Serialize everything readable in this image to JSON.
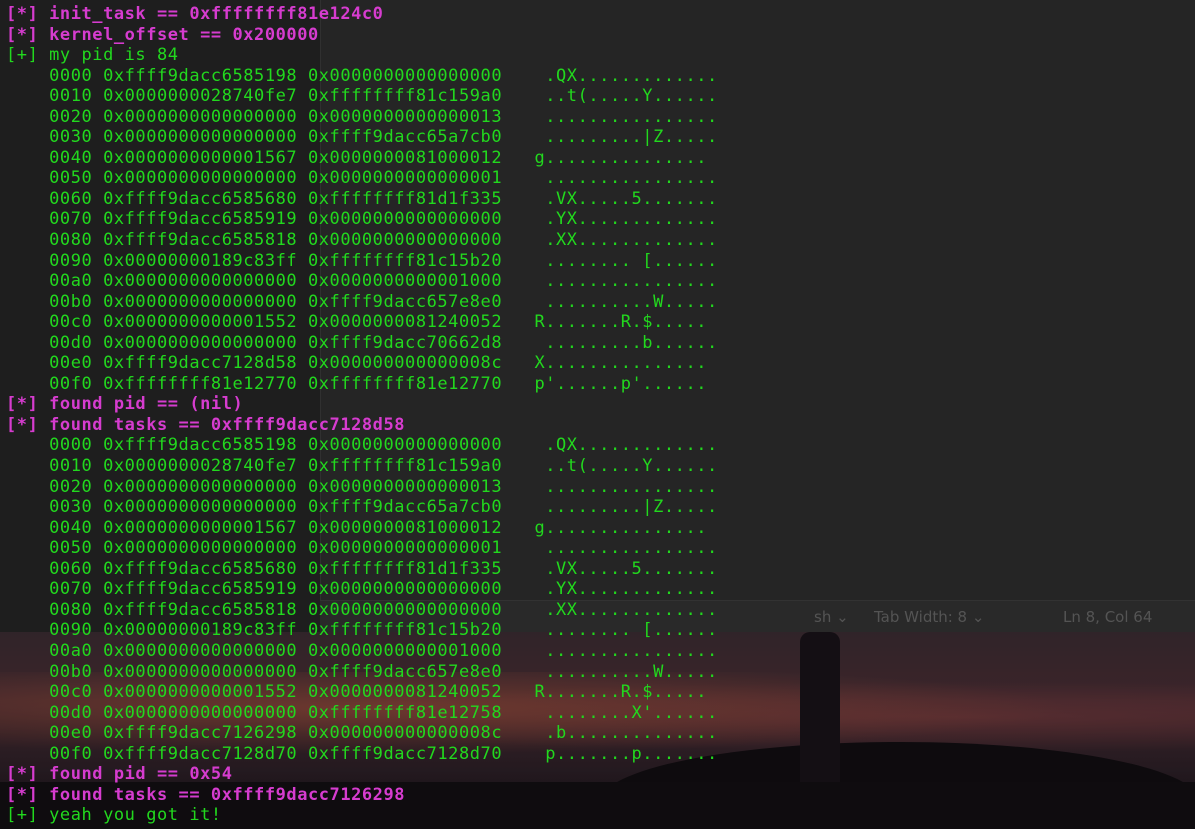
{
  "background_editor": {
    "language_label": "sh ⌄",
    "tab_width_label": "Tab Width: 8 ⌄",
    "cursor_position": "Ln 8, Col 64"
  },
  "colors": {
    "status_marker": "#d63ccf",
    "output": "#22d81e"
  },
  "terminal": {
    "lines": [
      {
        "kind": "status",
        "text": "[*] init_task == 0xffffffff81e124c0"
      },
      {
        "kind": "status",
        "text": "[*] kernel_offset == 0x200000"
      },
      {
        "kind": "info",
        "text": "[+] my pid is 84"
      },
      {
        "kind": "dump",
        "text": "    0000 0xffff9dacc6585198 0x0000000000000000    .QX............."
      },
      {
        "kind": "dump",
        "text": "    0010 0x0000000028740fe7 0xffffffff81c159a0    ..t(.....Y......"
      },
      {
        "kind": "dump",
        "text": "    0020 0x0000000000000000 0x0000000000000013    ................"
      },
      {
        "kind": "dump",
        "text": "    0030 0x0000000000000000 0xffff9dacc65a7cb0    .........|Z....."
      },
      {
        "kind": "dump",
        "text": "    0040 0x0000000000001567 0x0000000081000012   g..............."
      },
      {
        "kind": "dump",
        "text": "    0050 0x0000000000000000 0x0000000000000001    ................"
      },
      {
        "kind": "dump",
        "text": "    0060 0xffff9dacc6585680 0xffffffff81d1f335    .VX.....5......."
      },
      {
        "kind": "dump",
        "text": "    0070 0xffff9dacc6585919 0x0000000000000000    .YX............."
      },
      {
        "kind": "dump",
        "text": "    0080 0xffff9dacc6585818 0x0000000000000000    .XX............."
      },
      {
        "kind": "dump",
        "text": "    0090 0x00000000189c83ff 0xffffffff81c15b20    ........ [......"
      },
      {
        "kind": "dump",
        "text": "    00a0 0x0000000000000000 0x0000000000001000    ................"
      },
      {
        "kind": "dump",
        "text": "    00b0 0x0000000000000000 0xffff9dacc657e8e0    ..........W....."
      },
      {
        "kind": "dump",
        "text": "    00c0 0x0000000000001552 0x0000000081240052   R.......R.$....."
      },
      {
        "kind": "dump",
        "text": "    00d0 0x0000000000000000 0xffff9dacc70662d8    .........b......"
      },
      {
        "kind": "dump",
        "text": "    00e0 0xffff9dacc7128d58 0x000000000000008c   X..............."
      },
      {
        "kind": "dump",
        "text": "    00f0 0xffffffff81e12770 0xffffffff81e12770   p'......p'......"
      },
      {
        "kind": "status",
        "text": "[*] found pid == (nil)"
      },
      {
        "kind": "status",
        "text": "[*] found tasks == 0xffff9dacc7128d58"
      },
      {
        "kind": "dump",
        "text": "    0000 0xffff9dacc6585198 0x0000000000000000    .QX............."
      },
      {
        "kind": "dump",
        "text": "    0010 0x0000000028740fe7 0xffffffff81c159a0    ..t(.....Y......"
      },
      {
        "kind": "dump",
        "text": "    0020 0x0000000000000000 0x0000000000000013    ................"
      },
      {
        "kind": "dump",
        "text": "    0030 0x0000000000000000 0xffff9dacc65a7cb0    .........|Z....."
      },
      {
        "kind": "dump",
        "text": "    0040 0x0000000000001567 0x0000000081000012   g..............."
      },
      {
        "kind": "dump",
        "text": "    0050 0x0000000000000000 0x0000000000000001    ................"
      },
      {
        "kind": "dump",
        "text": "    0060 0xffff9dacc6585680 0xffffffff81d1f335    .VX.....5......."
      },
      {
        "kind": "dump",
        "text": "    0070 0xffff9dacc6585919 0x0000000000000000    .YX............."
      },
      {
        "kind": "dump",
        "text": "    0080 0xffff9dacc6585818 0x0000000000000000    .XX............."
      },
      {
        "kind": "dump",
        "text": "    0090 0x00000000189c83ff 0xffffffff81c15b20    ........ [......"
      },
      {
        "kind": "dump",
        "text": "    00a0 0x0000000000000000 0x0000000000001000    ................"
      },
      {
        "kind": "dump",
        "text": "    00b0 0x0000000000000000 0xffff9dacc657e8e0    ..........W....."
      },
      {
        "kind": "dump",
        "text": "    00c0 0x0000000000001552 0x0000000081240052   R.......R.$....."
      },
      {
        "kind": "dump",
        "text": "    00d0 0x0000000000000000 0xffffffff81e12758    ........X'......"
      },
      {
        "kind": "dump",
        "text": "    00e0 0xffff9dacc7126298 0x000000000000008c    .b.............."
      },
      {
        "kind": "dump",
        "text": "    00f0 0xffff9dacc7128d70 0xffff9dacc7128d70    p.......p......."
      },
      {
        "kind": "status",
        "text": "[*] found pid == 0x54"
      },
      {
        "kind": "status",
        "text": "[*] found tasks == 0xffff9dacc7126298"
      },
      {
        "kind": "info",
        "text": "[+] yeah you got it!"
      }
    ]
  }
}
